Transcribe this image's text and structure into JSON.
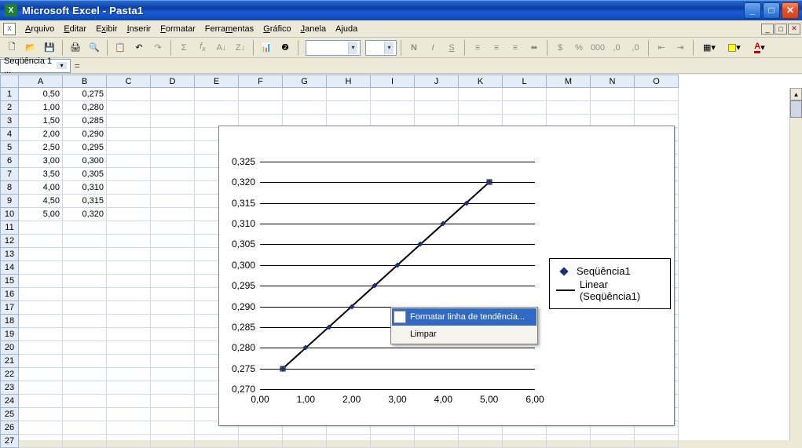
{
  "titlebar": {
    "title": "Microsoft Excel - Pasta1",
    "app_icon_char": "X"
  },
  "menu": [
    "Arquivo",
    "Editar",
    "Exibir",
    "Inserir",
    "Formatar",
    "Ferramentas",
    "Gráfico",
    "Janela",
    "Ajuda"
  ],
  "menu_underline_idx": [
    0,
    0,
    1,
    0,
    0,
    5,
    0,
    0,
    1
  ],
  "name_box": "Seqüência 1 ...",
  "columns": [
    "A",
    "B",
    "C",
    "D",
    "E",
    "F",
    "G",
    "H",
    "I",
    "J",
    "K",
    "L",
    "M",
    "N",
    "O"
  ],
  "row_count": 27,
  "sheet": {
    "A": [
      "0,50",
      "1,00",
      "1,50",
      "2,00",
      "2,50",
      "3,00",
      "3,50",
      "4,00",
      "4,50",
      "5,00"
    ],
    "B": [
      "0,275",
      "0,280",
      "0,285",
      "0,290",
      "0,295",
      "0,300",
      "0,305",
      "0,310",
      "0,315",
      "0,320"
    ]
  },
  "chart_data": {
    "type": "scatter",
    "series": [
      {
        "name": "Seqüência1",
        "x": [
          0.5,
          1.0,
          1.5,
          2.0,
          2.5,
          3.0,
          3.5,
          4.0,
          4.5,
          5.0
        ],
        "y": [
          0.275,
          0.28,
          0.285,
          0.29,
          0.295,
          0.3,
          0.305,
          0.31,
          0.315,
          0.32
        ]
      }
    ],
    "trendline": {
      "label": "Linear (Seqüência1)",
      "type": "linear"
    },
    "xticks": [
      "0,00",
      "1,00",
      "2,00",
      "3,00",
      "4,00",
      "5,00",
      "6,00"
    ],
    "yticks": [
      "0,270",
      "0,275",
      "0,280",
      "0,285",
      "0,290",
      "0,295",
      "0,300",
      "0,305",
      "0,310",
      "0,315",
      "0,320",
      "0,325"
    ],
    "xlim": [
      0,
      6
    ],
    "ylim": [
      0.27,
      0.325
    ]
  },
  "legend": {
    "series_label": "Seqüência1",
    "trend_label": "Linear (Seqüência1)"
  },
  "context_menu": {
    "format": "Formatar linha de tendência...",
    "clear": "Limpar"
  },
  "tooltips": {
    "new": "Novo",
    "open": "Abrir",
    "save": "Salvar",
    "print": "Imprimir",
    "preview": "Vista prévia",
    "copy_fmt": "Copiar formato",
    "undo": "Desfazer",
    "redo": "Refazer",
    "sum": "Soma",
    "fx": "fx",
    "sort_asc": "Classif asc",
    "sort_desc": "Classif desc",
    "chart": "Assistente de gráfico",
    "help": "Ajuda",
    "bold": "N",
    "italic": "I",
    "underline": "S"
  }
}
